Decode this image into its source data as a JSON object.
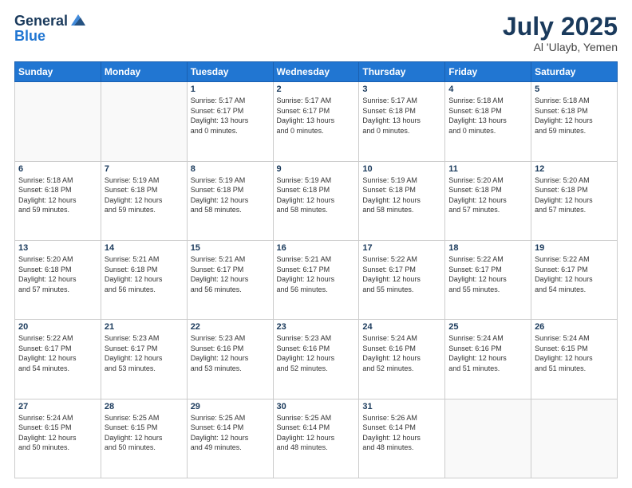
{
  "header": {
    "logo_general": "General",
    "logo_blue": "Blue",
    "title": "July 2025",
    "location": "Al 'Ulayb, Yemen"
  },
  "days_of_week": [
    "Sunday",
    "Monday",
    "Tuesday",
    "Wednesday",
    "Thursday",
    "Friday",
    "Saturday"
  ],
  "weeks": [
    [
      {
        "day": "",
        "info": ""
      },
      {
        "day": "",
        "info": ""
      },
      {
        "day": "1",
        "info": "Sunrise: 5:17 AM\nSunset: 6:17 PM\nDaylight: 13 hours\nand 0 minutes."
      },
      {
        "day": "2",
        "info": "Sunrise: 5:17 AM\nSunset: 6:17 PM\nDaylight: 13 hours\nand 0 minutes."
      },
      {
        "day": "3",
        "info": "Sunrise: 5:17 AM\nSunset: 6:18 PM\nDaylight: 13 hours\nand 0 minutes."
      },
      {
        "day": "4",
        "info": "Sunrise: 5:18 AM\nSunset: 6:18 PM\nDaylight: 13 hours\nand 0 minutes."
      },
      {
        "day": "5",
        "info": "Sunrise: 5:18 AM\nSunset: 6:18 PM\nDaylight: 12 hours\nand 59 minutes."
      }
    ],
    [
      {
        "day": "6",
        "info": "Sunrise: 5:18 AM\nSunset: 6:18 PM\nDaylight: 12 hours\nand 59 minutes."
      },
      {
        "day": "7",
        "info": "Sunrise: 5:19 AM\nSunset: 6:18 PM\nDaylight: 12 hours\nand 59 minutes."
      },
      {
        "day": "8",
        "info": "Sunrise: 5:19 AM\nSunset: 6:18 PM\nDaylight: 12 hours\nand 58 minutes."
      },
      {
        "day": "9",
        "info": "Sunrise: 5:19 AM\nSunset: 6:18 PM\nDaylight: 12 hours\nand 58 minutes."
      },
      {
        "day": "10",
        "info": "Sunrise: 5:19 AM\nSunset: 6:18 PM\nDaylight: 12 hours\nand 58 minutes."
      },
      {
        "day": "11",
        "info": "Sunrise: 5:20 AM\nSunset: 6:18 PM\nDaylight: 12 hours\nand 57 minutes."
      },
      {
        "day": "12",
        "info": "Sunrise: 5:20 AM\nSunset: 6:18 PM\nDaylight: 12 hours\nand 57 minutes."
      }
    ],
    [
      {
        "day": "13",
        "info": "Sunrise: 5:20 AM\nSunset: 6:18 PM\nDaylight: 12 hours\nand 57 minutes."
      },
      {
        "day": "14",
        "info": "Sunrise: 5:21 AM\nSunset: 6:18 PM\nDaylight: 12 hours\nand 56 minutes."
      },
      {
        "day": "15",
        "info": "Sunrise: 5:21 AM\nSunset: 6:17 PM\nDaylight: 12 hours\nand 56 minutes."
      },
      {
        "day": "16",
        "info": "Sunrise: 5:21 AM\nSunset: 6:17 PM\nDaylight: 12 hours\nand 56 minutes."
      },
      {
        "day": "17",
        "info": "Sunrise: 5:22 AM\nSunset: 6:17 PM\nDaylight: 12 hours\nand 55 minutes."
      },
      {
        "day": "18",
        "info": "Sunrise: 5:22 AM\nSunset: 6:17 PM\nDaylight: 12 hours\nand 55 minutes."
      },
      {
        "day": "19",
        "info": "Sunrise: 5:22 AM\nSunset: 6:17 PM\nDaylight: 12 hours\nand 54 minutes."
      }
    ],
    [
      {
        "day": "20",
        "info": "Sunrise: 5:22 AM\nSunset: 6:17 PM\nDaylight: 12 hours\nand 54 minutes."
      },
      {
        "day": "21",
        "info": "Sunrise: 5:23 AM\nSunset: 6:17 PM\nDaylight: 12 hours\nand 53 minutes."
      },
      {
        "day": "22",
        "info": "Sunrise: 5:23 AM\nSunset: 6:16 PM\nDaylight: 12 hours\nand 53 minutes."
      },
      {
        "day": "23",
        "info": "Sunrise: 5:23 AM\nSunset: 6:16 PM\nDaylight: 12 hours\nand 52 minutes."
      },
      {
        "day": "24",
        "info": "Sunrise: 5:24 AM\nSunset: 6:16 PM\nDaylight: 12 hours\nand 52 minutes."
      },
      {
        "day": "25",
        "info": "Sunrise: 5:24 AM\nSunset: 6:16 PM\nDaylight: 12 hours\nand 51 minutes."
      },
      {
        "day": "26",
        "info": "Sunrise: 5:24 AM\nSunset: 6:15 PM\nDaylight: 12 hours\nand 51 minutes."
      }
    ],
    [
      {
        "day": "27",
        "info": "Sunrise: 5:24 AM\nSunset: 6:15 PM\nDaylight: 12 hours\nand 50 minutes."
      },
      {
        "day": "28",
        "info": "Sunrise: 5:25 AM\nSunset: 6:15 PM\nDaylight: 12 hours\nand 50 minutes."
      },
      {
        "day": "29",
        "info": "Sunrise: 5:25 AM\nSunset: 6:14 PM\nDaylight: 12 hours\nand 49 minutes."
      },
      {
        "day": "30",
        "info": "Sunrise: 5:25 AM\nSunset: 6:14 PM\nDaylight: 12 hours\nand 48 minutes."
      },
      {
        "day": "31",
        "info": "Sunrise: 5:26 AM\nSunset: 6:14 PM\nDaylight: 12 hours\nand 48 minutes."
      },
      {
        "day": "",
        "info": ""
      },
      {
        "day": "",
        "info": ""
      }
    ]
  ]
}
